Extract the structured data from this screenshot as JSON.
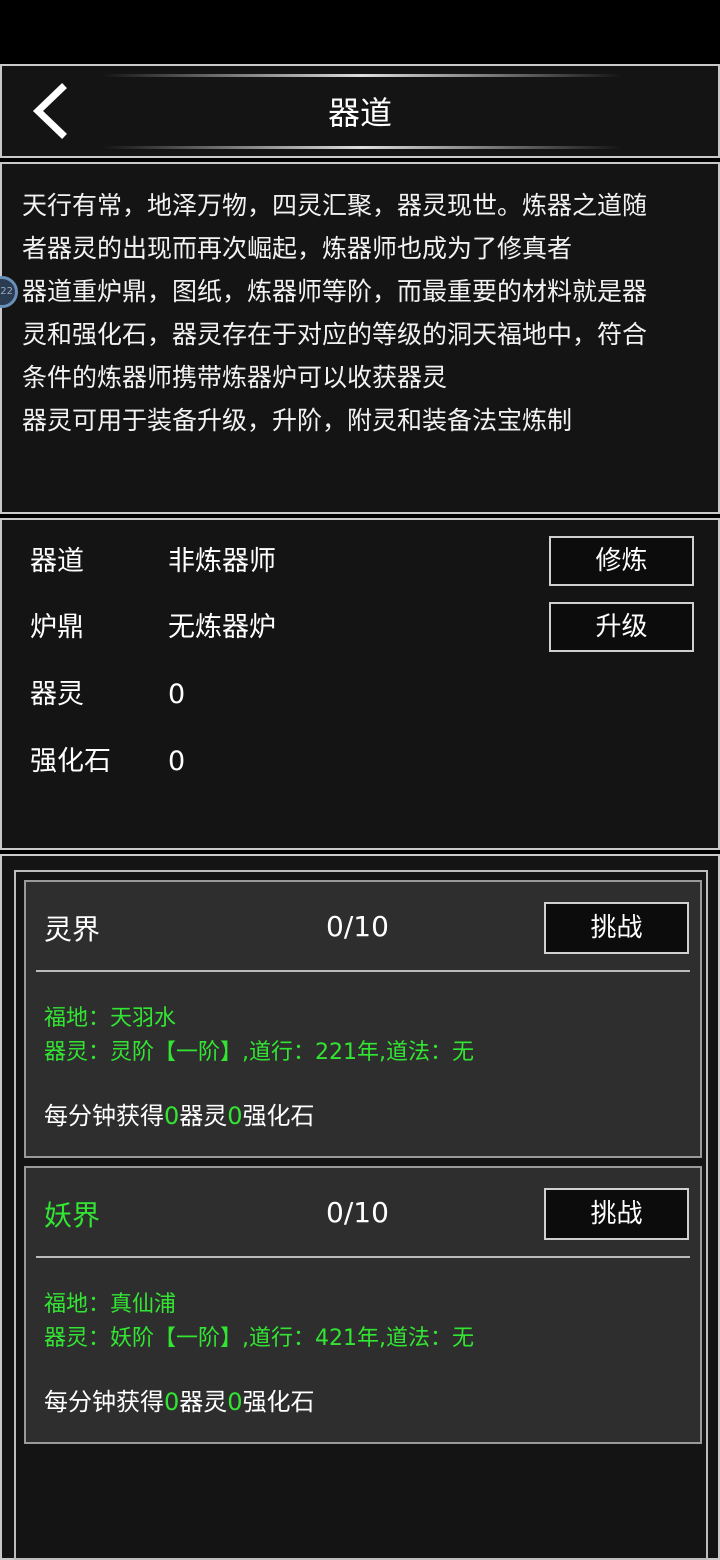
{
  "header": {
    "title": "器道"
  },
  "description": {
    "lines": [
      "天行有常，地泽万物，四灵汇聚，器灵现世。炼器之道随",
      "者器灵的出现而再次崛起，炼器师也成为了修真者",
      "器道重炉鼎，图纸，炼器师等阶，而最重要的材料就是器",
      "灵和强化石，器灵存在于对应的等级的洞天福地中，符合",
      "条件的炼器师携带炼器炉可以收获器灵",
      "器灵可用于装备升级，升阶，附灵和装备法宝炼制"
    ],
    "bubble_text": "22"
  },
  "stats": {
    "rows": [
      {
        "label": "器道",
        "value": "非炼器师"
      },
      {
        "label": "炉鼎",
        "value": "无炼器炉"
      },
      {
        "label": "器灵",
        "value": "0"
      },
      {
        "label": "强化石",
        "value": "0"
      }
    ],
    "train_label": "修炼",
    "upgrade_label": "升级"
  },
  "realms": [
    {
      "name": "灵界",
      "name_color": "#ffffff",
      "count": "0/10",
      "challenge_label": "挑战",
      "location": "福地：天羽水",
      "spirit": "器灵：灵阶【一阶】,道行：221年,道法：无",
      "gain_prefix": "每分钟获得",
      "spirit_gain": "0",
      "gain_mid": "器灵",
      "stone_gain": "0",
      "gain_suffix": "强化石"
    },
    {
      "name": "妖界",
      "name_color": "#33e533",
      "count": "0/10",
      "challenge_label": "挑战",
      "location": "福地：真仙浦",
      "spirit": "器灵：妖阶【一阶】,道行：421年,道法：无",
      "gain_prefix": "每分钟获得",
      "spirit_gain": "0",
      "gain_mid": "器灵",
      "stone_gain": "0",
      "gain_suffix": "强化石"
    }
  ]
}
